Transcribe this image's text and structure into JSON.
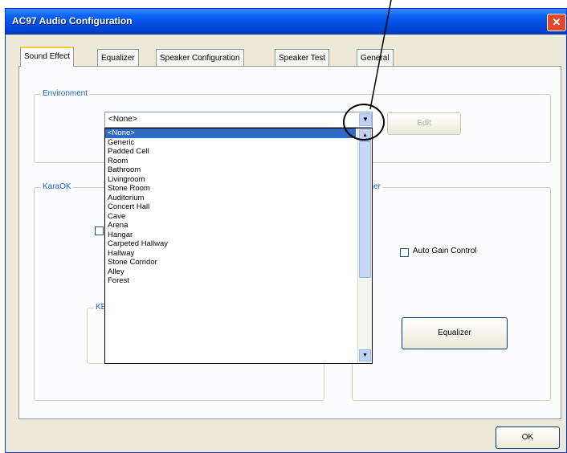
{
  "window": {
    "title": "AC97 Audio Configuration",
    "close_label": "✕"
  },
  "tabs": [
    {
      "label": "Sound Effect",
      "active": true
    },
    {
      "label": "Equalizer",
      "active": false
    },
    {
      "label": "Speaker Configuration",
      "active": false
    },
    {
      "label": "Speaker Test",
      "active": false
    },
    {
      "label": "General",
      "active": false
    }
  ],
  "environment": {
    "group_label": "Environment",
    "selected_value": "<None>",
    "edit_button": "Edit",
    "options": [
      "<None>",
      "Generic",
      "Padded Cell",
      "Room",
      "Bathroom",
      "Livingroom",
      "Stone Room",
      "Auditorium",
      "Concert Hall",
      "Cave",
      "Arena",
      "Hangar",
      "Carpeted Hallway",
      "Hallway",
      "Stone Corridor",
      "Alley",
      "Forest"
    ]
  },
  "karaoke": {
    "group_label": "KaraOK",
    "sub_label": "KE"
  },
  "other_group": {
    "group_label": "Other",
    "auto_gain_label": "Auto Gain Control",
    "equalizer_button": "Equalizer"
  },
  "footer": {
    "ok_button": "OK"
  }
}
